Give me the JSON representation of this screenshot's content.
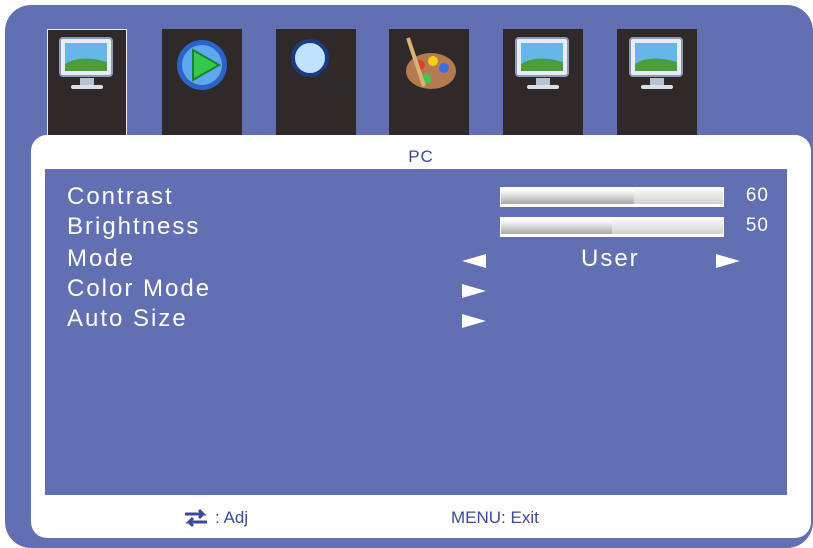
{
  "tabs": [
    {
      "icon": "picture-monitor-icon",
      "selected": true
    },
    {
      "icon": "play-globe-icon",
      "selected": false
    },
    {
      "icon": "magnifier-icon",
      "selected": false
    },
    {
      "icon": "paint-palette-icon",
      "selected": false
    },
    {
      "icon": "monitor-icon",
      "selected": false
    },
    {
      "icon": "monitor-icon",
      "selected": false
    }
  ],
  "panel": {
    "title": "PC"
  },
  "menu": {
    "contrast": {
      "label": "Contrast",
      "value": "60",
      "fraction": 0.6
    },
    "brightness": {
      "label": "Brightness",
      "value": "50",
      "fraction": 0.5
    },
    "mode": {
      "label": "Mode",
      "value": "User"
    },
    "color_mode": {
      "label": "Color Mode"
    },
    "auto_size": {
      "label": "Auto Size"
    }
  },
  "footer": {
    "adjust_label": ": Adj",
    "exit_label": "MENU: Exit"
  },
  "colors": {
    "background": "#6270b3",
    "panel": "#ffffff",
    "tab": "#30292a",
    "accent_text": "#3c4a96"
  }
}
